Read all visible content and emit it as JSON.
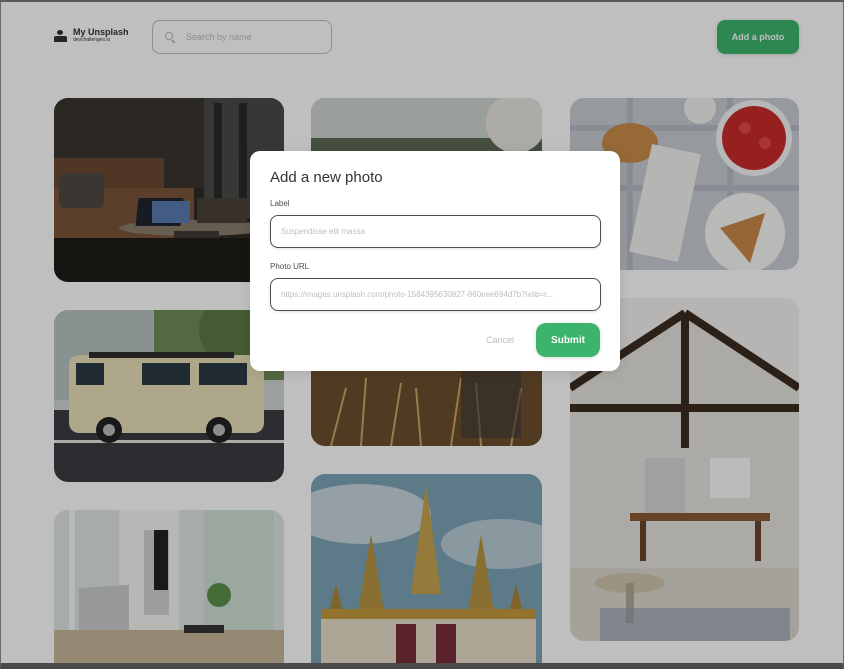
{
  "header": {
    "app_title": "My Unsplash",
    "app_subtitle": "devchallenges.io",
    "search_placeholder": "Search by name",
    "add_photo_label": "Add a photo"
  },
  "gallery": {
    "photos": [
      {
        "subject": "living room with laptop on coffee table"
      },
      {
        "subject": "person in wheat field"
      },
      {
        "subject": "croissants, strawberries and boxed water"
      },
      {
        "subject": "cream vintage van parked on street"
      },
      {
        "subject": "open loft kitchen with wooden beams"
      },
      {
        "subject": "laptop on desk by window"
      },
      {
        "subject": "golden temple roofs"
      }
    ]
  },
  "modal": {
    "title": "Add a new photo",
    "label_field_label": "Label",
    "label_placeholder": "Suspendisse elit massa",
    "url_field_label": "Photo URL",
    "url_placeholder": "https://images.unsplash.com/photo-1584395630827-860eee694d7b?ixlib=r...",
    "cancel_label": "Cancel",
    "submit_label": "Submit"
  },
  "colors": {
    "accent": "#3db46d",
    "overlay": "rgba(0,0,0,0.25)",
    "text": "#333333",
    "muted": "#bdbdbd"
  }
}
